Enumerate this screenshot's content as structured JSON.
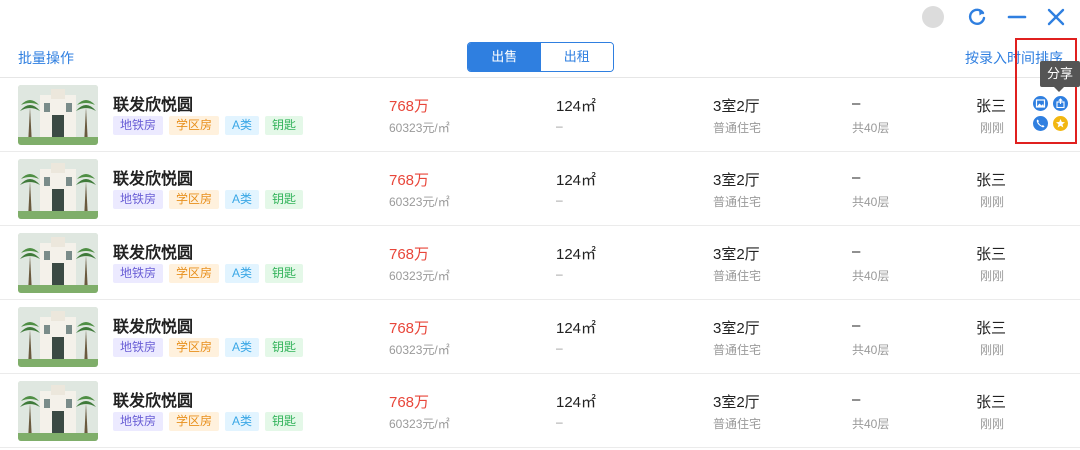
{
  "window": {
    "controls": {
      "refresh_icon": "refresh-icon",
      "minimize_icon": "minimize-icon",
      "close_icon": "close-icon"
    }
  },
  "toolbar": {
    "batch_label": "批量操作",
    "tabs": [
      {
        "label": "出售",
        "active": true
      },
      {
        "label": "出租",
        "active": false
      }
    ],
    "sort_label": "按录入时间排序"
  },
  "tooltip": {
    "text": "分享"
  },
  "colors": {
    "accent": "#2f7fe0",
    "price": "#e8463a",
    "highlight": "#e0201f",
    "star": "#f2b712"
  },
  "listings": [
    {
      "name": "联发欣悦圆",
      "tags": [
        "地铁房",
        "学区房",
        "A类",
        "钥匙"
      ],
      "price": "768万",
      "unit_price": "60323元/㎡",
      "area": "124㎡",
      "area_sub": "–",
      "layout": "3室2厅",
      "property_type": "普通住宅",
      "floor": "–",
      "floor_total": "共40层",
      "agent": "张三",
      "time": "刚刚"
    },
    {
      "name": "联发欣悦圆",
      "tags": [
        "地铁房",
        "学区房",
        "A类",
        "钥匙"
      ],
      "price": "768万",
      "unit_price": "60323元/㎡",
      "area": "124㎡",
      "area_sub": "–",
      "layout": "3室2厅",
      "property_type": "普通住宅",
      "floor": "–",
      "floor_total": "共40层",
      "agent": "张三",
      "time": "刚刚"
    },
    {
      "name": "联发欣悦圆",
      "tags": [
        "地铁房",
        "学区房",
        "A类",
        "钥匙"
      ],
      "price": "768万",
      "unit_price": "60323元/㎡",
      "area": "124㎡",
      "area_sub": "–",
      "layout": "3室2厅",
      "property_type": "普通住宅",
      "floor": "–",
      "floor_total": "共40层",
      "agent": "张三",
      "time": "刚刚"
    },
    {
      "name": "联发欣悦圆",
      "tags": [
        "地铁房",
        "学区房",
        "A类",
        "钥匙"
      ],
      "price": "768万",
      "unit_price": "60323元/㎡",
      "area": "124㎡",
      "area_sub": "–",
      "layout": "3室2厅",
      "property_type": "普通住宅",
      "floor": "–",
      "floor_total": "共40层",
      "agent": "张三",
      "time": "刚刚"
    },
    {
      "name": "联发欣悦圆",
      "tags": [
        "地铁房",
        "学区房",
        "A类",
        "钥匙"
      ],
      "price": "768万",
      "unit_price": "60323元/㎡",
      "area": "124㎡",
      "area_sub": "–",
      "layout": "3室2厅",
      "property_type": "普通住宅",
      "floor": "–",
      "floor_total": "共40层",
      "agent": "张三",
      "time": "刚刚"
    }
  ]
}
